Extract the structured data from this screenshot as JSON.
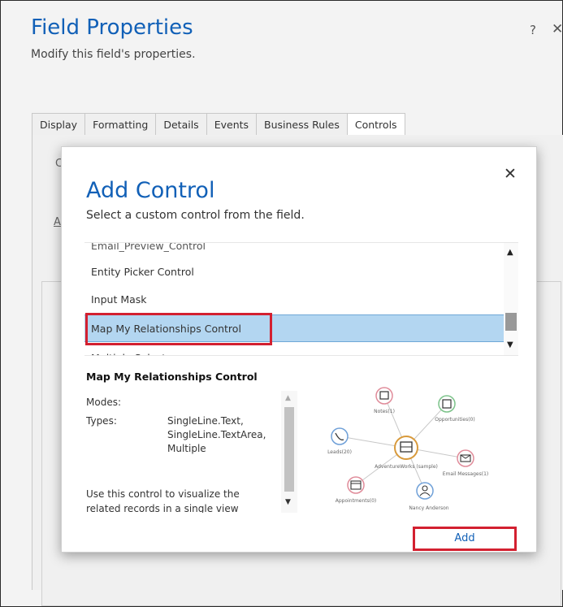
{
  "field_properties": {
    "title": "Field Properties",
    "subtitle": "Modify this field's properties.",
    "help_label": "?",
    "close_label": "✕",
    "tabs": [
      {
        "label": "Display"
      },
      {
        "label": "Formatting"
      },
      {
        "label": "Details"
      },
      {
        "label": "Events"
      },
      {
        "label": "Business Rules"
      },
      {
        "label": "Controls"
      }
    ],
    "active_tab": "Controls",
    "fragment_c": "C",
    "fragment_a": "A"
  },
  "add_control_dialog": {
    "close_label": "✕",
    "title": "Add Control",
    "subtitle": "Select a custom control from the field.",
    "list_items": [
      {
        "label": "Email_Preview_Control"
      },
      {
        "label": "Entity Picker Control"
      },
      {
        "label": "Input Mask"
      },
      {
        "label": "Map My Relationships Control"
      },
      {
        "label": "Multiple Select"
      }
    ],
    "selected_item": "Map My Relationships Control",
    "scroll_up": "▲",
    "scroll_down": "▼",
    "detail": {
      "title": "Map My Relationships Control",
      "modes_label": "Modes:",
      "types_label": "Types:",
      "types_values": [
        "SingleLine.Text,",
        "SingleLine.TextArea,",
        "Multiple"
      ],
      "description": "Use this control to visualize the related records in a single view"
    },
    "preview": {
      "center_label": "AdventureWorks (sample)",
      "nodes": [
        {
          "label": "Notes(1)",
          "icon": "note-icon"
        },
        {
          "label": "Opportunities(0)",
          "icon": "opportunity-icon"
        },
        {
          "label": "Leads(20)",
          "icon": "phone-icon"
        },
        {
          "label": "Email Messages(1)",
          "icon": "email-icon"
        },
        {
          "label": "Appointments(0)",
          "icon": "calendar-icon"
        },
        {
          "label": "Nancy Anderson",
          "icon": "person-icon"
        }
      ]
    },
    "add_button_label": "Add"
  },
  "colors": {
    "title_blue": "#1160b7",
    "selection_blue": "#b3d6f1",
    "highlight_red": "#d32030"
  }
}
